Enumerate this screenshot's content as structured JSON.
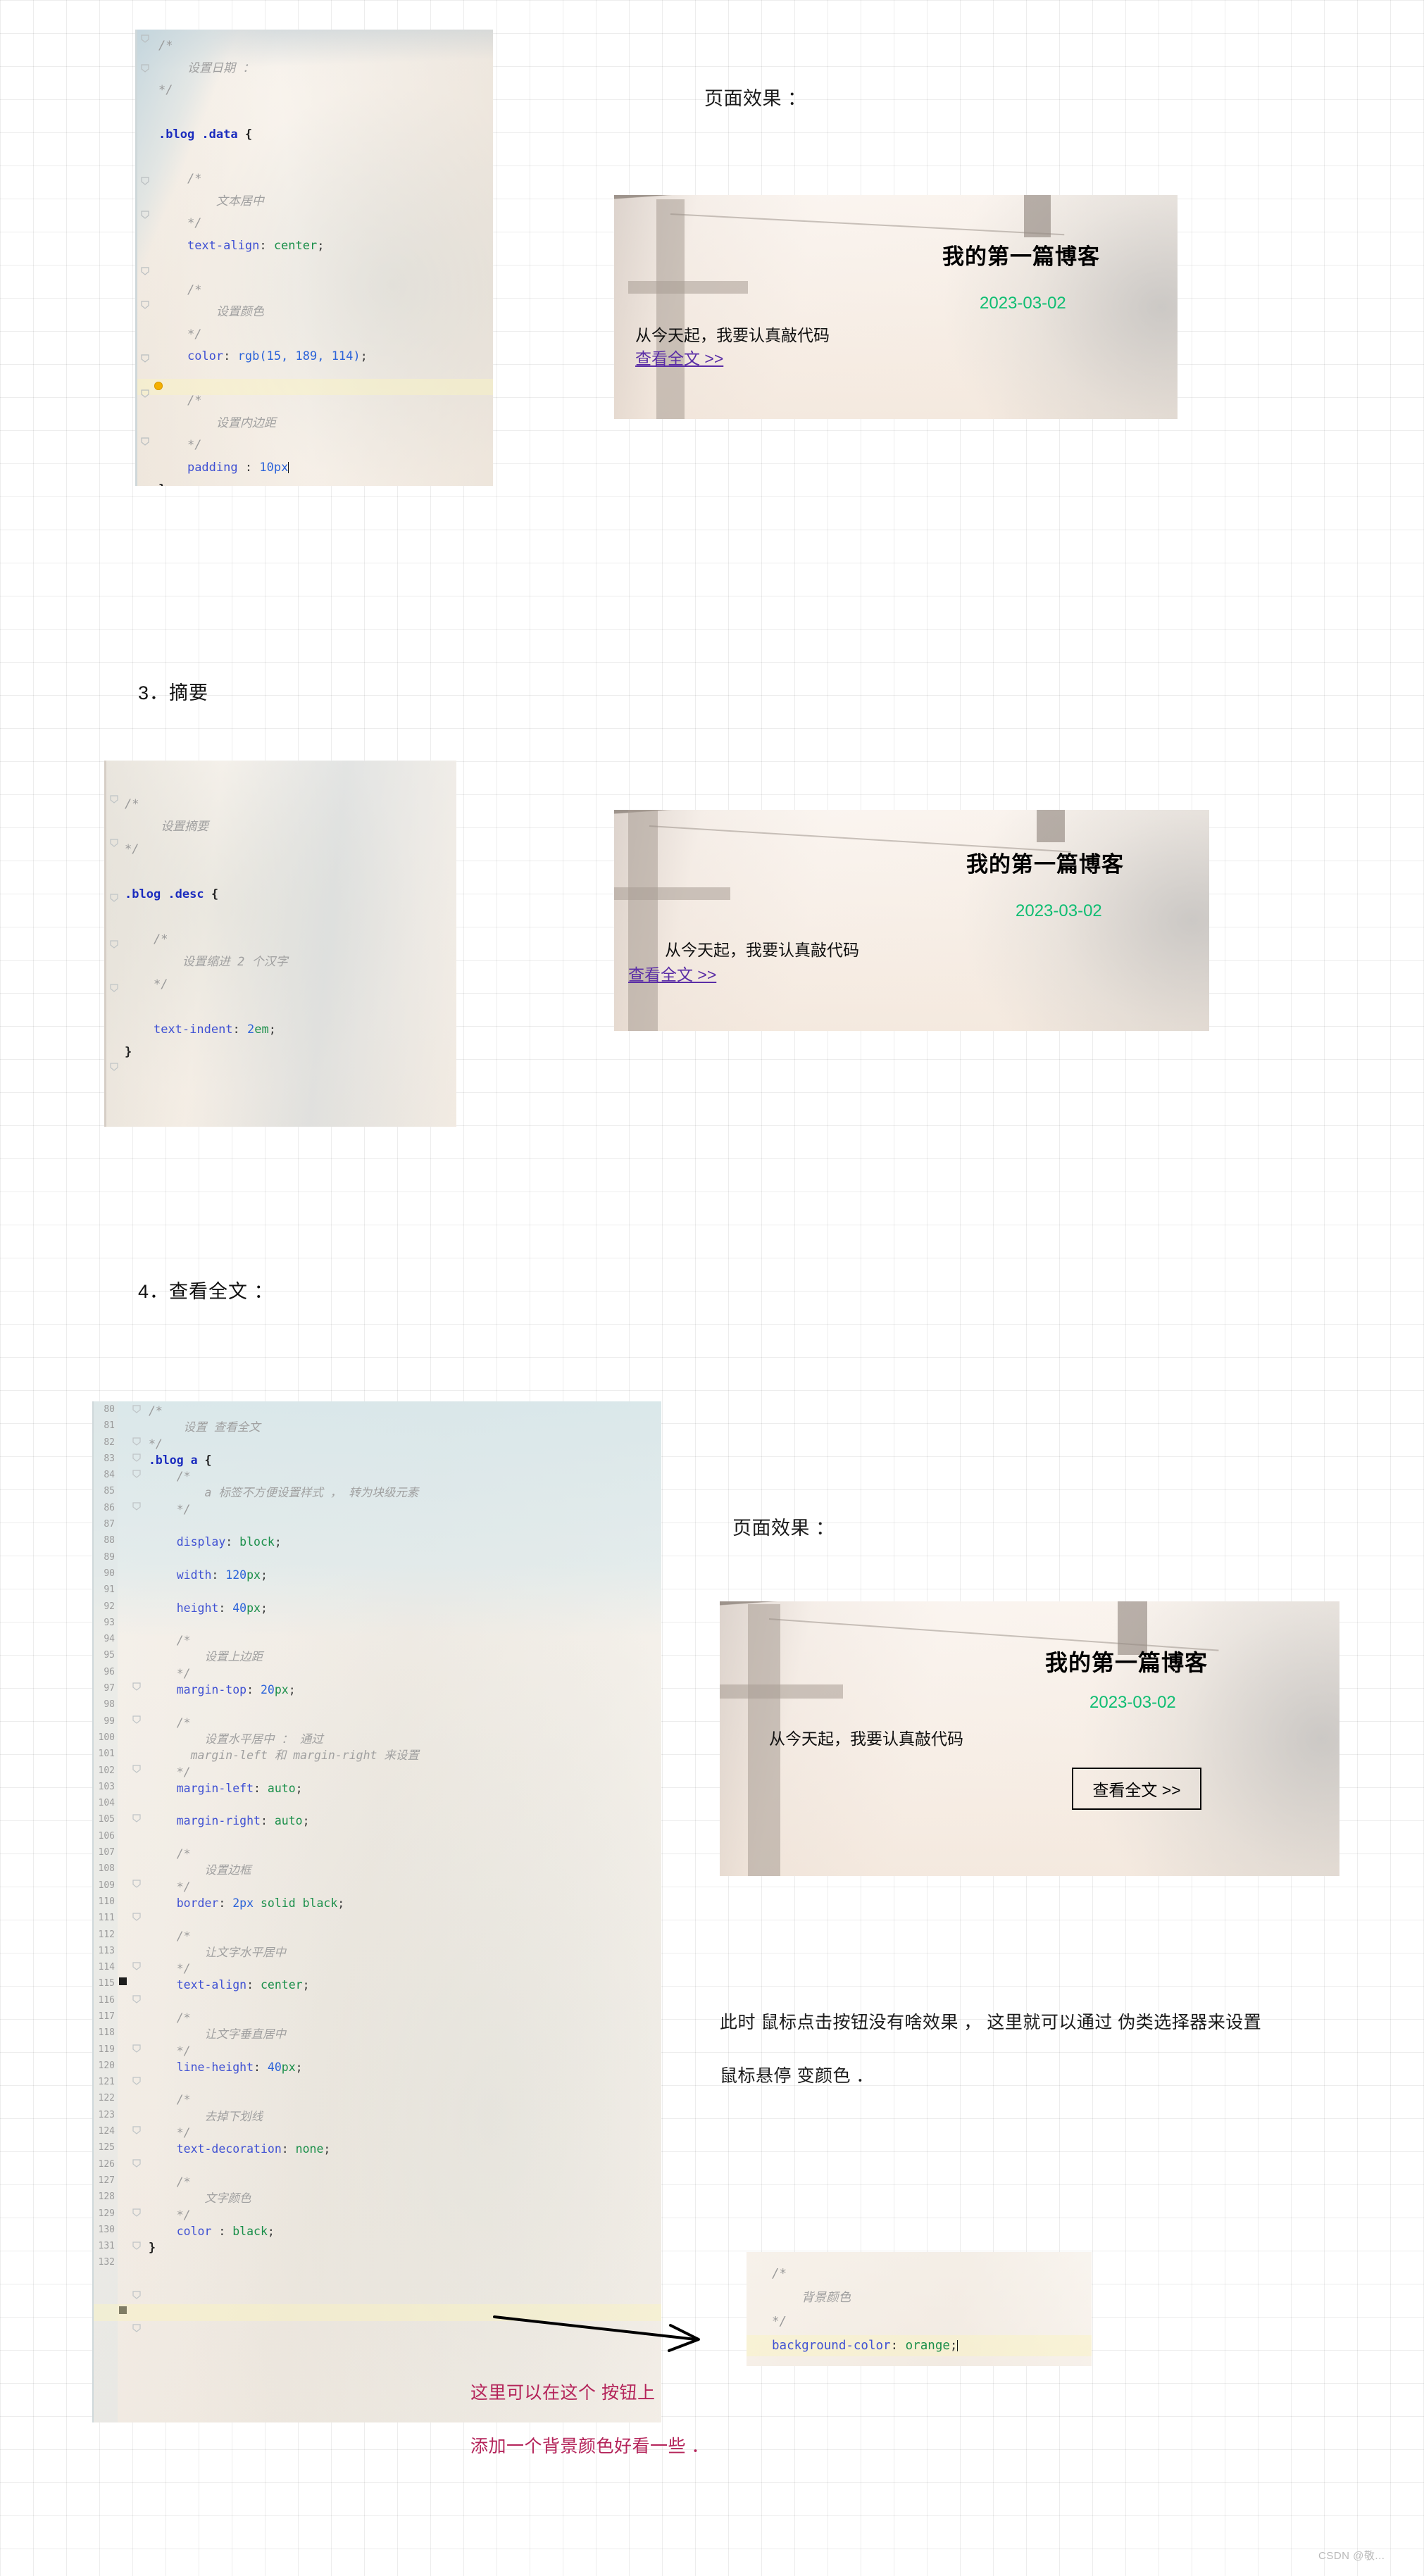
{
  "document": {
    "watermark": "CSDN @敬..."
  },
  "section_date": {
    "code": {
      "lines": [
        "/*",
        "     设置日期 :",
        "*/",
        "",
        ".blog .data {",
        "",
        "    /*",
        "         文本居中",
        "    */",
        "    text-align: center;",
        "",
        "    /*",
        "         设置颜色",
        "    */",
        "    color: rgb(15, 189, 114);",
        "",
        "    /*",
        "         设置内边距",
        "    */",
        "    padding : 10px",
        "}"
      ]
    },
    "preview_label": "页面效果 ："
  },
  "section_summary": {
    "heading": "3．摘要",
    "code": {
      "lines": [
        "/*",
        "     设置摘要",
        "*/",
        "",
        ".blog .desc {",
        "",
        "    /*",
        "         设置缩进 2 个汉字",
        "    */",
        "",
        "    text-indent: 2em;",
        "}"
      ]
    }
  },
  "section_readmore": {
    "heading": "4．查看全文 ：",
    "preview_label": "页面效果 ：",
    "code": {
      "first_line_number": 80,
      "lines": [
        "/*",
        "     设置 查看全文",
        "*/",
        ".blog a {",
        "    /*",
        "        a 标签不方便设置样式 ， 转为块级元素",
        "    */",
        "",
        "    display: block;",
        "",
        "    width: 120px;",
        "",
        "    height: 40px;",
        "",
        "    /*",
        "        设置上边距",
        "    */",
        "    margin-top: 20px;",
        "",
        "    /*",
        "        设置水平居中 ： 通过",
        "      margin-left 和 margin-right 来设置",
        "    */",
        "    margin-left: auto;",
        "",
        "    margin-right: auto;",
        "",
        "    /*",
        "        设置边框",
        "    */",
        "    border: 2px solid black;",
        "",
        "    /*",
        "        让文字水平居中",
        "    */",
        "    text-align: center;",
        "",
        "    /*",
        "        让文字垂直居中",
        "    */",
        "    line-height: 40px;",
        "",
        "    /*",
        "        去掉下划线",
        "    */",
        "    text-decoration: none;",
        "",
        "    /*",
        "        文字颜色",
        "    */",
        "    color : black;",
        "}",
        ""
      ]
    },
    "explain_line1": "此时 鼠标点击按钮没有啥效果 ， 这里就可以通过 伪类选择器来设置",
    "explain_line2": "鼠标悬停 变颜色 ．",
    "hover_code": {
      "lines": [
        "/*",
        "     背景颜色",
        "*/",
        "background-color: orange;"
      ]
    },
    "red_note_line1": "这里可以在这个 按钮上",
    "red_note_line2": "添加一个背景颜色好看一些 ．"
  },
  "preview_content": {
    "title": "我的第一篇博客",
    "date": "2023-03-02",
    "desc": "从今天起，我要认真敲代码",
    "link": "查看全文 >>",
    "button": "查看全文 >>"
  },
  "colors": {
    "date_green": "#0fbd72",
    "link_purple": "#5b2ea6",
    "red_annotation": "#b4245a",
    "code_keyword": "#3f51d3",
    "code_value": "#1a8f4a",
    "code_comment": "#9a9a9a"
  }
}
